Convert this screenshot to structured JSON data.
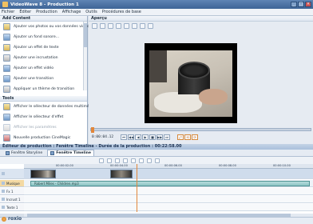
{
  "window": {
    "title": "VideoWave 8 - Production 1"
  },
  "menu": [
    "Fichier",
    "Éditer",
    "Production",
    "Affichage",
    "Outils",
    "Procédures de base"
  ],
  "left_panel": {
    "add_section": "Add Content",
    "add_items": [
      "Ajouter vos photos ou vos données vidéo",
      "Ajouter un fond sonore...",
      "Ajouter un effet de texte",
      "Ajouter une incrustation",
      "Ajouter un effet vidéo",
      "Ajouter une transition",
      "Appliquer un thème de transition"
    ],
    "tools_section": "Tools",
    "tools_items": [
      "Afficher le sélecteur de données multimédia",
      "Afficher le sélecteur d'effet",
      "Afficher les paramètres",
      "Nouvelle production CineMagic",
      "Nouveau diaporama"
    ]
  },
  "preview": {
    "title": "Aperçu",
    "timecode": "0:00:04.12",
    "controls": [
      "⏮",
      "◀◀",
      "◀",
      "▶",
      "■",
      "▶▶",
      "⏭",
      "⤢",
      "⟲",
      "⟳"
    ]
  },
  "production": {
    "title": "Éditeur de production : Fenêtre Timeline - Durée de la production : 00:22:58.00",
    "tabs": [
      "Fenêtre Storyline",
      "Fenêtre Timeline"
    ],
    "ruler_ticks": [
      "00:00:02.00",
      "00:00:04.00",
      "00:00:06.00",
      "00:00:08.00",
      "00:00:10.00"
    ],
    "tracks": [
      "",
      "Musique",
      "Fx 1",
      "Incrust 1",
      "Texte 1"
    ],
    "music_clip": "Robert Miles - Children.mp3"
  },
  "brand": "roxio"
}
